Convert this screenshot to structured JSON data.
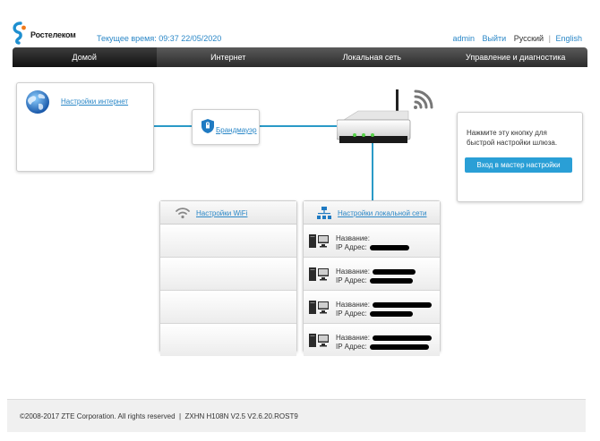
{
  "brand": {
    "name": "Ростелеком"
  },
  "header": {
    "clock_label": "Текущее время: 09:37 22/05/2020",
    "links": {
      "admin": "admin",
      "logout": "Выйти",
      "lang_ru": "Русский",
      "separator": "|",
      "lang_en": "English"
    }
  },
  "nav": {
    "tabs": [
      {
        "label": "Домой"
      },
      {
        "label": "Интернет"
      },
      {
        "label": "Локальная сеть"
      },
      {
        "label": "Управление и диагностика"
      }
    ]
  },
  "internet": {
    "label": "Настройки интернет",
    "icon": "globe-icon"
  },
  "firewall": {
    "label": "Брандмауэр",
    "icon": "shield-icon"
  },
  "router": {
    "icon": "router-icon",
    "wifi_icon": "wifi-signal-icon"
  },
  "wizard": {
    "text": "Нажмите эту кнопку для быстрой настройки шлюза.",
    "button": "Вход в мастер настройки"
  },
  "wifi": {
    "label": "Настройки WiFi",
    "icon": "wifi-icon"
  },
  "lan": {
    "label": "Настройки локальной сети",
    "icon": "network-icon",
    "devices": [
      {
        "name_label": "Название:",
        "ip_label": "IP Адрес:"
      },
      {
        "name_label": "Название:",
        "ip_label": "IP Адрес:"
      },
      {
        "name_label": "Название:",
        "ip_label": "IP Адрес:"
      },
      {
        "name_label": "Название:",
        "ip_label": "IP Адрес:"
      }
    ]
  },
  "footer": {
    "text": "©2008-2017 ZTE Corporation. All rights reserved  |  ZXHN H108N V2.5 V2.6.20.ROST9"
  },
  "colors": {
    "accent": "#2a87c7",
    "connector": "#2a9ac7",
    "button": "#2a9fd6",
    "nav_dark": "#2b2b2b"
  }
}
